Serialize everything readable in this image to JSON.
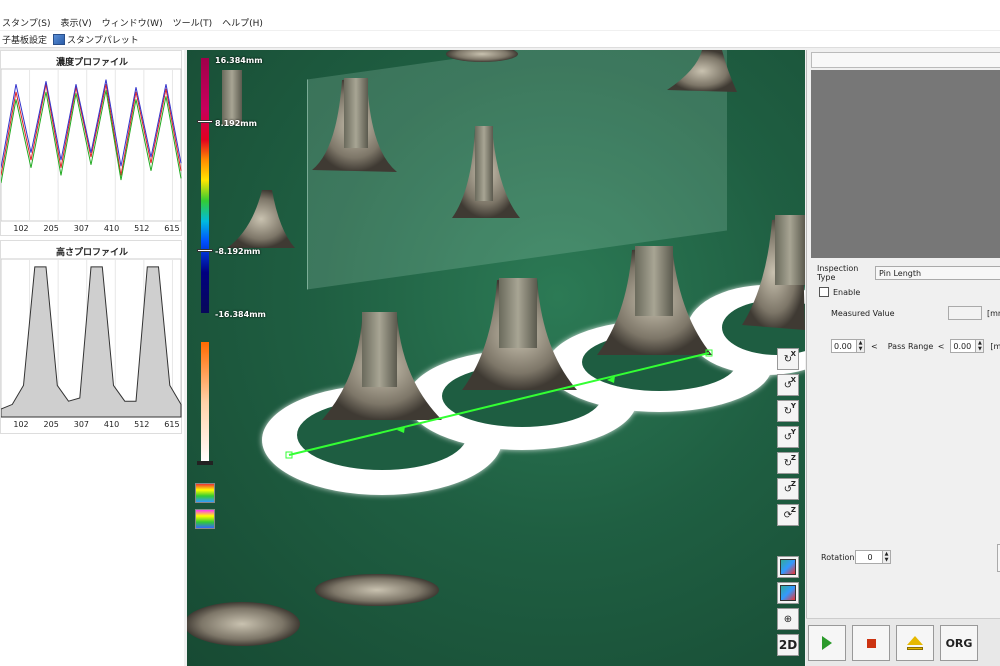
{
  "menu": {
    "items": [
      "スタンプ(S)",
      "表示(V)",
      "ウィンドウ(W)",
      "ツール(T)",
      "ヘルプ(H)"
    ]
  },
  "toolbar": {
    "btn1": "子基板設定",
    "btn2": "スタンプパレット"
  },
  "charts": {
    "density": {
      "title": "濃度プロファイル",
      "ticks": [
        "102",
        "205",
        "307",
        "410",
        "512",
        "615"
      ]
    },
    "height": {
      "title": "高さプロファイル",
      "ticks": [
        "102",
        "205",
        "307",
        "410",
        "512",
        "615"
      ]
    }
  },
  "chart_data": [
    {
      "type": "line",
      "title": "濃度プロファイル",
      "categories": [
        "102",
        "205",
        "307",
        "410",
        "512",
        "615"
      ],
      "series": [
        {
          "values": [
            0.3,
            0.85,
            0.4,
            0.9,
            0.35,
            0.88,
            0.42,
            0.9,
            0.3,
            0.85,
            0.38,
            0.87,
            0.33
          ]
        },
        {
          "values": [
            0.25,
            0.8,
            0.35,
            0.85,
            0.3,
            0.84,
            0.37,
            0.86,
            0.27,
            0.8,
            0.33,
            0.82,
            0.28
          ]
        },
        {
          "values": [
            0.35,
            0.9,
            0.45,
            0.92,
            0.4,
            0.9,
            0.45,
            0.93,
            0.36,
            0.88,
            0.42,
            0.9,
            0.38
          ]
        }
      ]
    },
    {
      "type": "area",
      "title": "高さプロファイル",
      "categories": [
        "102",
        "205",
        "307",
        "410",
        "512",
        "615"
      ],
      "series": [
        {
          "values": [
            0.05,
            0.08,
            0.2,
            0.95,
            0.95,
            0.2,
            0.1,
            0.12,
            0.95,
            0.95,
            0.2,
            0.1,
            0.1,
            0.95,
            0.95,
            0.2,
            0.08
          ]
        }
      ]
    }
  ],
  "colorscale": {
    "top": "16.384mm",
    "mid_upper": "8.192mm",
    "mid_lower": "-8.192mm",
    "bottom": "-16.384mm"
  },
  "rightpanel": {
    "inspection_label": "Inspection Type",
    "inspection_value": "Pin Length",
    "enable_label": "Enable",
    "measured_label": "Measured Value",
    "unit": "[mm",
    "min_value": "0.00",
    "lt1": "<",
    "pass_range_label": "Pass Range",
    "lt2": "<",
    "max_value": "0.00",
    "rotation_label": "Rotation",
    "rotation_value": "0"
  },
  "view_buttons": {
    "axes": [
      "X",
      "X",
      "Y",
      "Y",
      "Z",
      "Z",
      "Z"
    ],
    "mode_2d": "2D"
  },
  "bottom_buttons": {
    "org": "ORG"
  }
}
